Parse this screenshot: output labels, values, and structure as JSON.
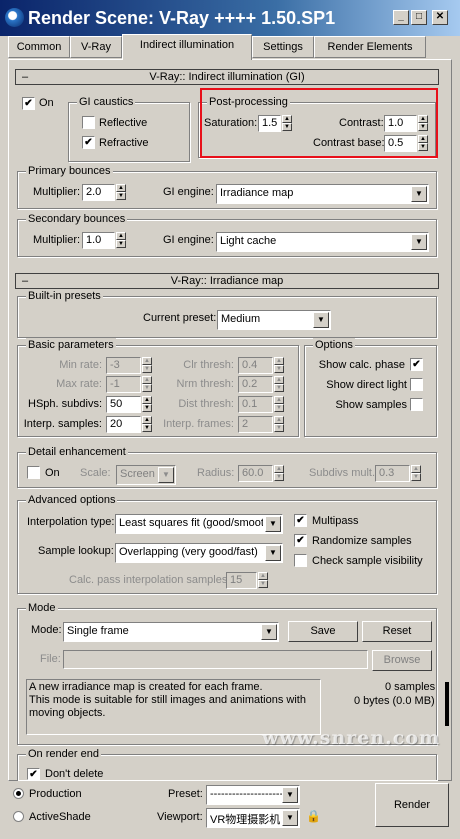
{
  "window": {
    "title": "Render Scene: V-Ray ++++ 1.50.SP1"
  },
  "tabs": [
    {
      "label": "Common"
    },
    {
      "label": "V-Ray"
    },
    {
      "label": "Indirect illumination",
      "active": true
    },
    {
      "label": "Settings"
    },
    {
      "label": "Render Elements"
    }
  ],
  "gi_rollout": {
    "title": "V-Ray:: Indirect illumination (GI)",
    "on_label": "On",
    "on_checked": true,
    "caustics": {
      "title": "GI caustics",
      "reflective": "Reflective",
      "reflective_checked": false,
      "refractive": "Refractive",
      "refractive_checked": true
    },
    "post": {
      "title": "Post-processing",
      "saturation_label": "Saturation:",
      "saturation": "1.5",
      "contrast_label": "Contrast:",
      "contrast": "1.0",
      "contrast_base_label": "Contrast base:",
      "contrast_base": "0.5"
    },
    "primary": {
      "title": "Primary bounces",
      "multiplier_label": "Multiplier:",
      "multiplier": "2.0",
      "engine_label": "GI engine:",
      "engine": "Irradiance map"
    },
    "secondary": {
      "title": "Secondary bounces",
      "multiplier_label": "Multiplier:",
      "multiplier": "1.0",
      "engine_label": "GI engine:",
      "engine": "Light cache"
    }
  },
  "irr_rollout": {
    "title": "V-Ray:: Irradiance map",
    "presets": {
      "title": "Built-in presets",
      "current_label": "Current preset:",
      "current": "Medium"
    },
    "basic": {
      "title": "Basic parameters",
      "min_rate_label": "Min rate:",
      "min_rate": "-3",
      "max_rate_label": "Max rate:",
      "max_rate": "-1",
      "hsph_label": "HSph. subdivs:",
      "hsph": "50",
      "interp_label": "Interp. samples:",
      "interp": "20",
      "clr_label": "Clr thresh:",
      "clr": "0.4",
      "nrm_label": "Nrm thresh:",
      "nrm": "0.2",
      "dist_label": "Dist thresh:",
      "dist": "0.1",
      "frames_label": "Interp. frames:",
      "frames": "2"
    },
    "options": {
      "title": "Options",
      "show_calc": "Show calc. phase",
      "show_calc_checked": true,
      "show_direct": "Show direct light",
      "show_direct_checked": false,
      "show_samples": "Show samples",
      "show_samples_checked": false
    },
    "detail": {
      "title": "Detail enhancement",
      "on_label": "On",
      "on_checked": false,
      "scale_label": "Scale:",
      "scale": "Screen",
      "radius_label": "Radius:",
      "radius": "60.0",
      "subdivs_label": "Subdivs mult.",
      "subdivs": "0.3"
    },
    "advanced": {
      "title": "Advanced options",
      "interp_type_label": "Interpolation type:",
      "interp_type": "Least squares fit (good/smooth",
      "lookup_label": "Sample lookup:",
      "lookup": "Overlapping (very good/fast)",
      "calc_label": "Calc. pass interpolation samples:",
      "calc": "15",
      "multipass": "Multipass",
      "multipass_checked": true,
      "randomize": "Randomize samples",
      "randomize_checked": true,
      "check_vis": "Check sample visibility",
      "check_vis_checked": false
    },
    "mode": {
      "title": "Mode",
      "mode_label": "Mode:",
      "mode": "Single frame",
      "save": "Save",
      "reset": "Reset",
      "file_label": "File:",
      "file": "",
      "browse": "Browse",
      "description": "A new irradiance map is created for each frame.\nThis mode is suitable for still images and animations with moving objects.",
      "samples": "0 samples",
      "bytes": "0 bytes (0.0 MB)"
    },
    "render_end": {
      "title": "On render end",
      "dont_delete": "Don't delete",
      "dont_delete_checked": true
    }
  },
  "bottom": {
    "production": "Production",
    "activeshade": "ActiveShade",
    "preset_label": "Preset:",
    "preset": "--------------------",
    "viewport_label": "Viewport:",
    "viewport": "VR物理摄影机",
    "render": "Render"
  },
  "watermark": "www.snren.com"
}
